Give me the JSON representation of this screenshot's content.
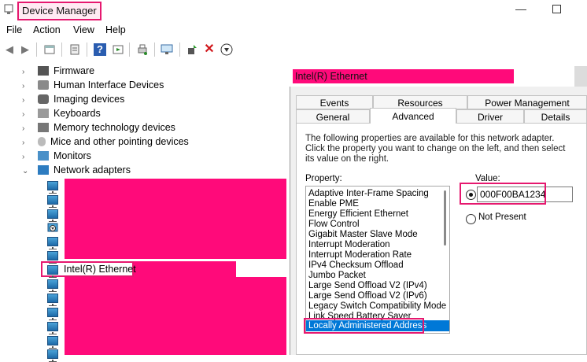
{
  "window": {
    "title": "Device Manager"
  },
  "menu": [
    "File",
    "Action",
    "View",
    "Help"
  ],
  "toolbar": {
    "icons": [
      "back-icon",
      "forward-icon",
      "properties-icon",
      "update-driver-icon",
      "help-icon",
      "view-icon",
      "print-icon",
      "monitor-icon",
      "enable-device-icon",
      "uninstall-icon",
      "download-icon"
    ]
  },
  "tree": {
    "categories": [
      "Firmware",
      "Human Interface Devices",
      "Imaging devices",
      "Keyboards",
      "Memory technology devices",
      "Mice and other pointing devices",
      "Monitors",
      "Network adapters"
    ],
    "selected_adapter": "Intel(R) Ethernet"
  },
  "dialog": {
    "title": "Intel(R) Ethernet",
    "tabs_row1": [
      "Events",
      "Resources",
      "Power Management"
    ],
    "tabs_row2": [
      "General",
      "Advanced",
      "Driver",
      "Details"
    ],
    "description": "The following properties are available for this network adapter. Click the property you want to change on the left, and then select its value on the right.",
    "property_label": "Property:",
    "value_label": "Value:",
    "properties": [
      "Adaptive Inter-Frame Spacing",
      "Enable PME",
      "Energy Efficient Ethernet",
      "Flow Control",
      "Gigabit Master Slave Mode",
      "Interrupt Moderation",
      "Interrupt Moderation Rate",
      "IPv4 Checksum Offload",
      "Jumbo Packet",
      "Large Send Offload V2 (IPv4)",
      "Large Send Offload V2 (IPv6)",
      "Legacy Switch Compatibility Mode",
      "Link Speed Battery Saver",
      "Locally Administered Address"
    ],
    "value": "000F00BA1234",
    "not_present_label": "Not Present"
  }
}
